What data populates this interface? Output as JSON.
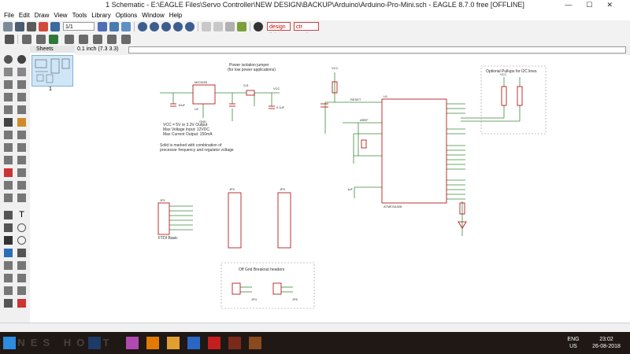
{
  "window": {
    "title": "1 Schematic - E:\\EAGLE Files\\Servo Controller\\NEW DESIGN\\BACKUP\\Arduino\\Arduino-Pro-Mini.sch - EAGLE 8.7.0 free [OFFLINE]",
    "minimize": "—",
    "maximize": "☐",
    "close": "✕"
  },
  "menu": [
    "File",
    "Edit",
    "Draw",
    "View",
    "Tools",
    "Library",
    "Options",
    "Window",
    "Help"
  ],
  "toolbar": {
    "sheet_select": "1/1",
    "design_link": "design link",
    "ctr_service": "ctr service"
  },
  "coordinates": "0.1 inch (7.3 3.3)",
  "sheets": {
    "header": "Sheets",
    "items": [
      {
        "number": "1"
      }
    ]
  },
  "schematic": {
    "labels": {
      "power_jumper": "Power isolation jumper",
      "power_jumper2": "(for low power applications)",
      "vcc_note1": "VCC = 5V or 3.3V Output",
      "vcc_note2": "Max Voltage Input: 12VDC",
      "vcc_note3": "Max Current Output: 150mA",
      "bold_note1": "Solid is marked with combination of",
      "bold_note2": "processor frequency and regulator voltage",
      "i2c_note": "Optional Pullups for I2C lines",
      "ftdi_label": "FTDI Basic",
      "off_grid": "Off Grid Breakout headers",
      "reg_name": "MIC5205",
      "cap1": "10uF",
      "cap2": "0.1uF",
      "cap3": "1uF",
      "mcu_name": "ATMEGA328",
      "reset": "RESET",
      "aref": "AREF",
      "vcc": "VCC",
      "gnd": "GND",
      "jp1": "JP1",
      "jp2": "JP2",
      "jp3": "JP3",
      "jp4": "JP4",
      "jp5": "JP5",
      "jp6": "JP6",
      "sj1": "SJ1",
      "u1": "U1",
      "u2": "U2"
    }
  },
  "taskbar": {
    "watermark": "ANES HODT",
    "lang": "ENG",
    "region": "US",
    "time": "23:02",
    "date": "26-08-2018"
  },
  "colors": {
    "wire": "#3a8a3a",
    "part": "#b00000",
    "text": "#303030",
    "frame": "#909090",
    "accent": "#2a74c4"
  }
}
